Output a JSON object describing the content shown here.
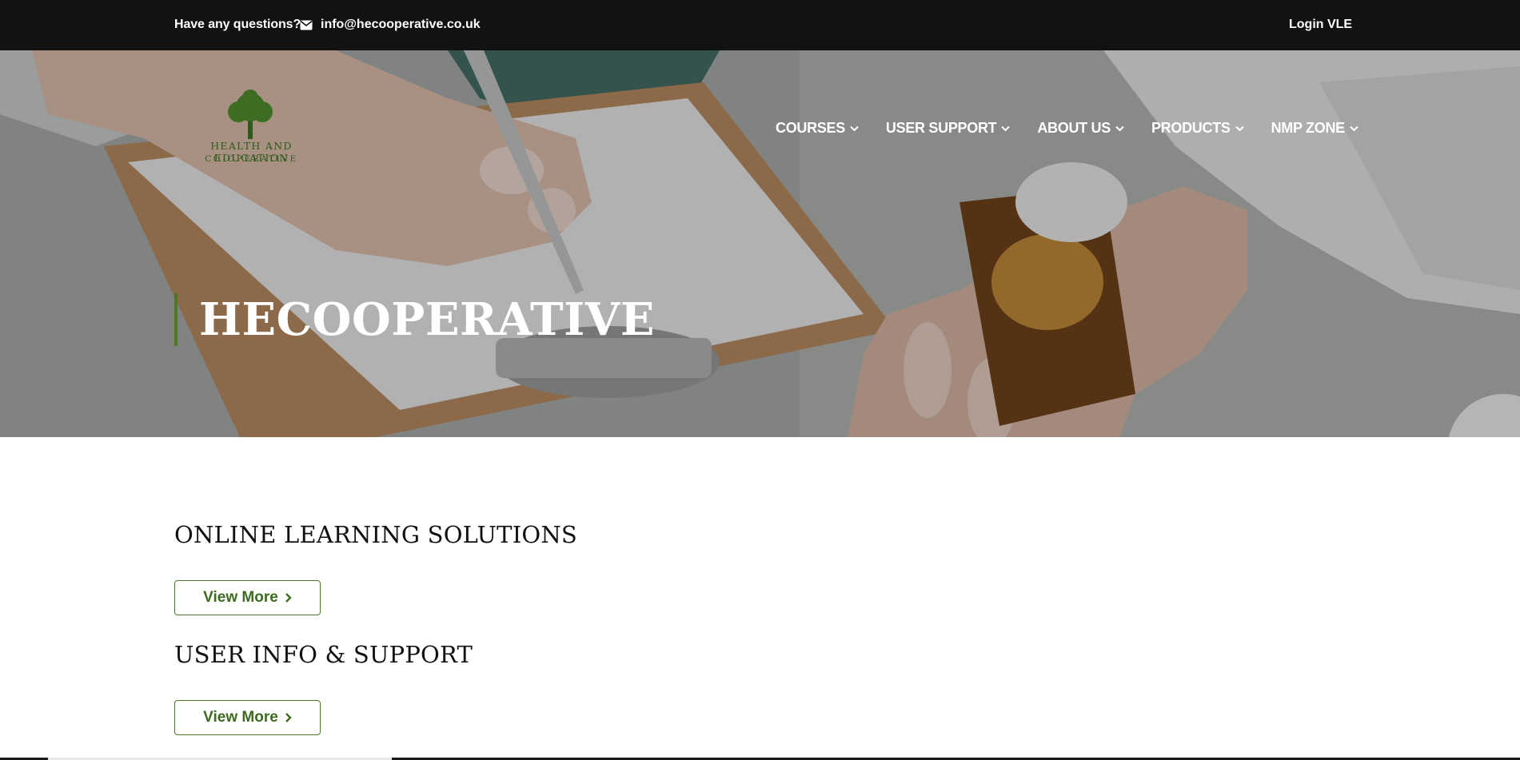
{
  "topbar": {
    "question": "Have any questions?",
    "email": "info@hecooperative.co.uk",
    "login": "Login VLE",
    "icon_mail": "envelope-icon"
  },
  "logo": {
    "line1": "HEALTH AND EDUCATION",
    "line2": "CO-OPERATIVE",
    "icon": "tree-logo"
  },
  "nav": {
    "items": [
      {
        "label": "COURSES"
      },
      {
        "label": "USER SUPPORT"
      },
      {
        "label": "ABOUT US"
      },
      {
        "label": "PRODUCTS"
      },
      {
        "label": "NMP ZONE"
      }
    ]
  },
  "hero": {
    "title": "HECOOPERATIVE"
  },
  "sections": [
    {
      "heading": "ONLINE LEARNING SOLUTIONS",
      "button": "View More"
    },
    {
      "heading": "USER INFO & SUPPORT",
      "button": "View More"
    }
  ],
  "colors": {
    "topbar_bg": "#121212",
    "accent_green": "#4a7a26",
    "button_text": "#3d6b1f"
  }
}
